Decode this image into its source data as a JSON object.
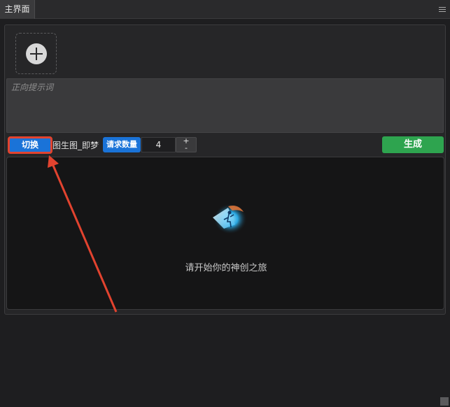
{
  "tab": {
    "title": "主界面"
  },
  "upload": {
    "icon": "add-circle-icon"
  },
  "prompt": {
    "placeholder": "正向提示词",
    "value": ""
  },
  "toolbar": {
    "switch_label": "切换",
    "mode_label": "图生图_即梦",
    "request_count_label": "请求数量",
    "request_count_value": "4",
    "stepper_plus": "+",
    "stepper_minus": "-",
    "generate_label": "生成"
  },
  "output": {
    "empty_message": "请开始你的神创之旅"
  },
  "colors": {
    "accent_blue": "#1a73d8",
    "generate_green": "#2ea44f",
    "highlight_red": "#e2432f"
  }
}
